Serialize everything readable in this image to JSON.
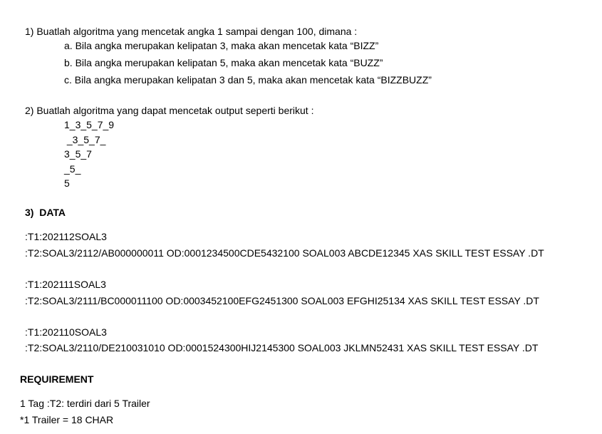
{
  "q1": {
    "title": "1) Buatlah algoritma yang mencetak angka 1 sampai dengan 100, dimana :",
    "items": [
      "a. Bila angka merupakan kelipatan 3, maka akan mencetak kata “BIZZ”",
      "b. Bila angka merupakan kelipatan 5, maka akan mencetak kata “BUZZ”",
      "c. Bila angka merupakan kelipatan 3 dan 5, maka akan mencetak kata “BIZZBUZZ”"
    ]
  },
  "q2": {
    "title": "2) Buatlah algoritma yang dapat mencetak output seperti berikut :",
    "pattern": [
      "1_3_5_7_9",
      " _3_5_7_",
      "3_5_7",
      "_5_",
      "5"
    ]
  },
  "q3": {
    "title": "3)  DATA",
    "records": [
      {
        "t1": ":T1:202112SOAL3",
        "t2": ":T2:SOAL3/2112/AB000000011 OD:0001234500CDE5432100 SOAL003 ABCDE12345 XAS SKILL TEST ESSAY .DT"
      },
      {
        "t1": ":T1:202111SOAL3",
        "t2": ":T2:SOAL3/2111/BC000011100 OD:0003452100EFG2451300 SOAL003 EFGHI25134 XAS SKILL TEST ESSAY .DT"
      },
      {
        "t1": ":T1:202110SOAL3",
        "t2": ":T2:SOAL3/2110/DE210031010 OD:0001524300HIJ2145300 SOAL003 JKLMN52431 XAS SKILL TEST ESSAY .DT"
      }
    ]
  },
  "requirement": {
    "title": "REQUIREMENT",
    "lines": [
      "1 Tag :T2: terdiri dari 5 Trailer",
      "*1 Trailer = 18 CHAR"
    ]
  }
}
